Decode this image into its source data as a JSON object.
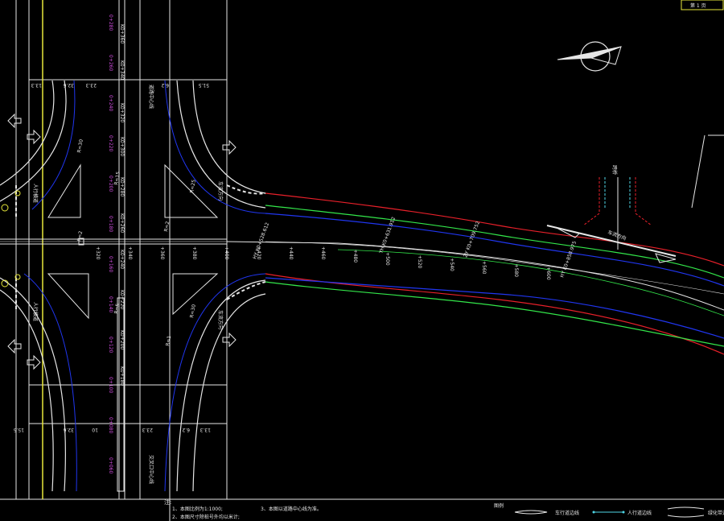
{
  "title_block": {
    "label": "第 1 页"
  },
  "stations_left": [
    "K0+280",
    "K0+260",
    "K0+240",
    "K0+220"
  ],
  "stations_main": [
    "K0+360",
    "K0+340",
    "K0+320",
    "K0+300",
    "K0+280",
    "K0+260",
    "K0+240",
    "K0+220",
    "K0+200",
    "K0+180"
  ],
  "station_labels_x": [
    "+320",
    "+340",
    "+360",
    "+380",
    "+400",
    "+420",
    "+440",
    "+460",
    "+480",
    "+500",
    "+520",
    "+540",
    "+560",
    "+580",
    "+600"
  ],
  "curve_points": [
    "HY K0+528.612",
    "YH K0+631.912",
    "ZY K0+709.752",
    "HY K0+858.975"
  ],
  "radii": [
    "R=30",
    "R=15",
    "R=2",
    "R=2",
    "R=25",
    "R=5",
    "R=30",
    "R=1"
  ],
  "dims_top": [
    "13.3",
    "32.6",
    "23.3",
    "6.2",
    "51.5"
  ],
  "dims_bottom": [
    "15.5",
    "32.6",
    "10",
    "23.3",
    "6.2",
    "13.3"
  ],
  "road_labels": [
    "道路中心线",
    "交叉口中心线",
    "人行横道",
    "人行横道"
  ],
  "flow_label": "车流方向",
  "bridge_label": "跨桥",
  "north": {
    "icon": "north-arrow-icon"
  },
  "notes": {
    "heading": "注:",
    "items": [
      "1、本图比例为1:1000;",
      "2、本图尺寸除桩号外均以米计;",
      "3、本图以道路中心线为准。"
    ]
  },
  "legend": {
    "heading": "图例",
    "items": [
      "车行道边线",
      "人行道边线",
      "绿化带边线"
    ]
  },
  "colors": {
    "red": "#e8202a",
    "green": "#33e64a",
    "blue": "#2036f0",
    "white": "#e6e6e6",
    "magenta": "#d04de0",
    "yellow": "#e8e83a",
    "cyan": "#4fd6e6"
  }
}
